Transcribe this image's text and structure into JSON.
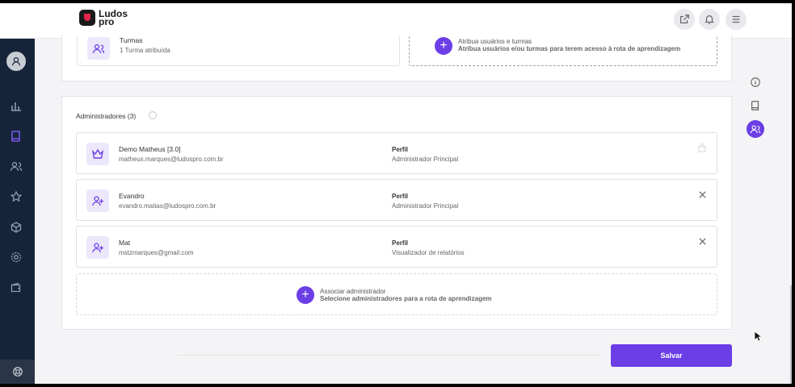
{
  "header": {
    "logo_line1": "Ludos",
    "logo_line2": "pro",
    "buttons": [
      "external-link",
      "bell",
      "menu"
    ]
  },
  "assignment": {
    "groups_title": "Turmas",
    "groups_sub": "1 Turma atribuída",
    "assign_title": "Atribua usuários e turmas",
    "assign_sub": "Atribua usuários e/ou turmas para terem acesso à rota de aprendizagem"
  },
  "admins": {
    "title": "Administradores (3)",
    "profile_label": "Perfil",
    "rows": [
      {
        "name": "Demo Matheus [3.0]",
        "email": "matheus.marques@ludospro.com.br",
        "profile": "Administrador Principal",
        "icon": "crown-icon",
        "action": "lock"
      },
      {
        "name": "Evandro",
        "email": "evandro.matias@ludospro.com.br",
        "profile": "Administrador Principal",
        "icon": "user-plus-icon",
        "action": "close"
      },
      {
        "name": "Mat",
        "email": "mstzmarques@gmail.com",
        "profile": "Visualizador de relatórios",
        "icon": "user-plus-icon",
        "action": "close"
      }
    ],
    "associate_title": "Associar administrador",
    "associate_sub": "Selecione administradores para a rota de aprendizagem"
  },
  "footer": {
    "save_label": "Salvar"
  },
  "colors": {
    "accent": "#6b3ee6",
    "sidebar": "#16243a",
    "brand_red": "#e3254a"
  }
}
